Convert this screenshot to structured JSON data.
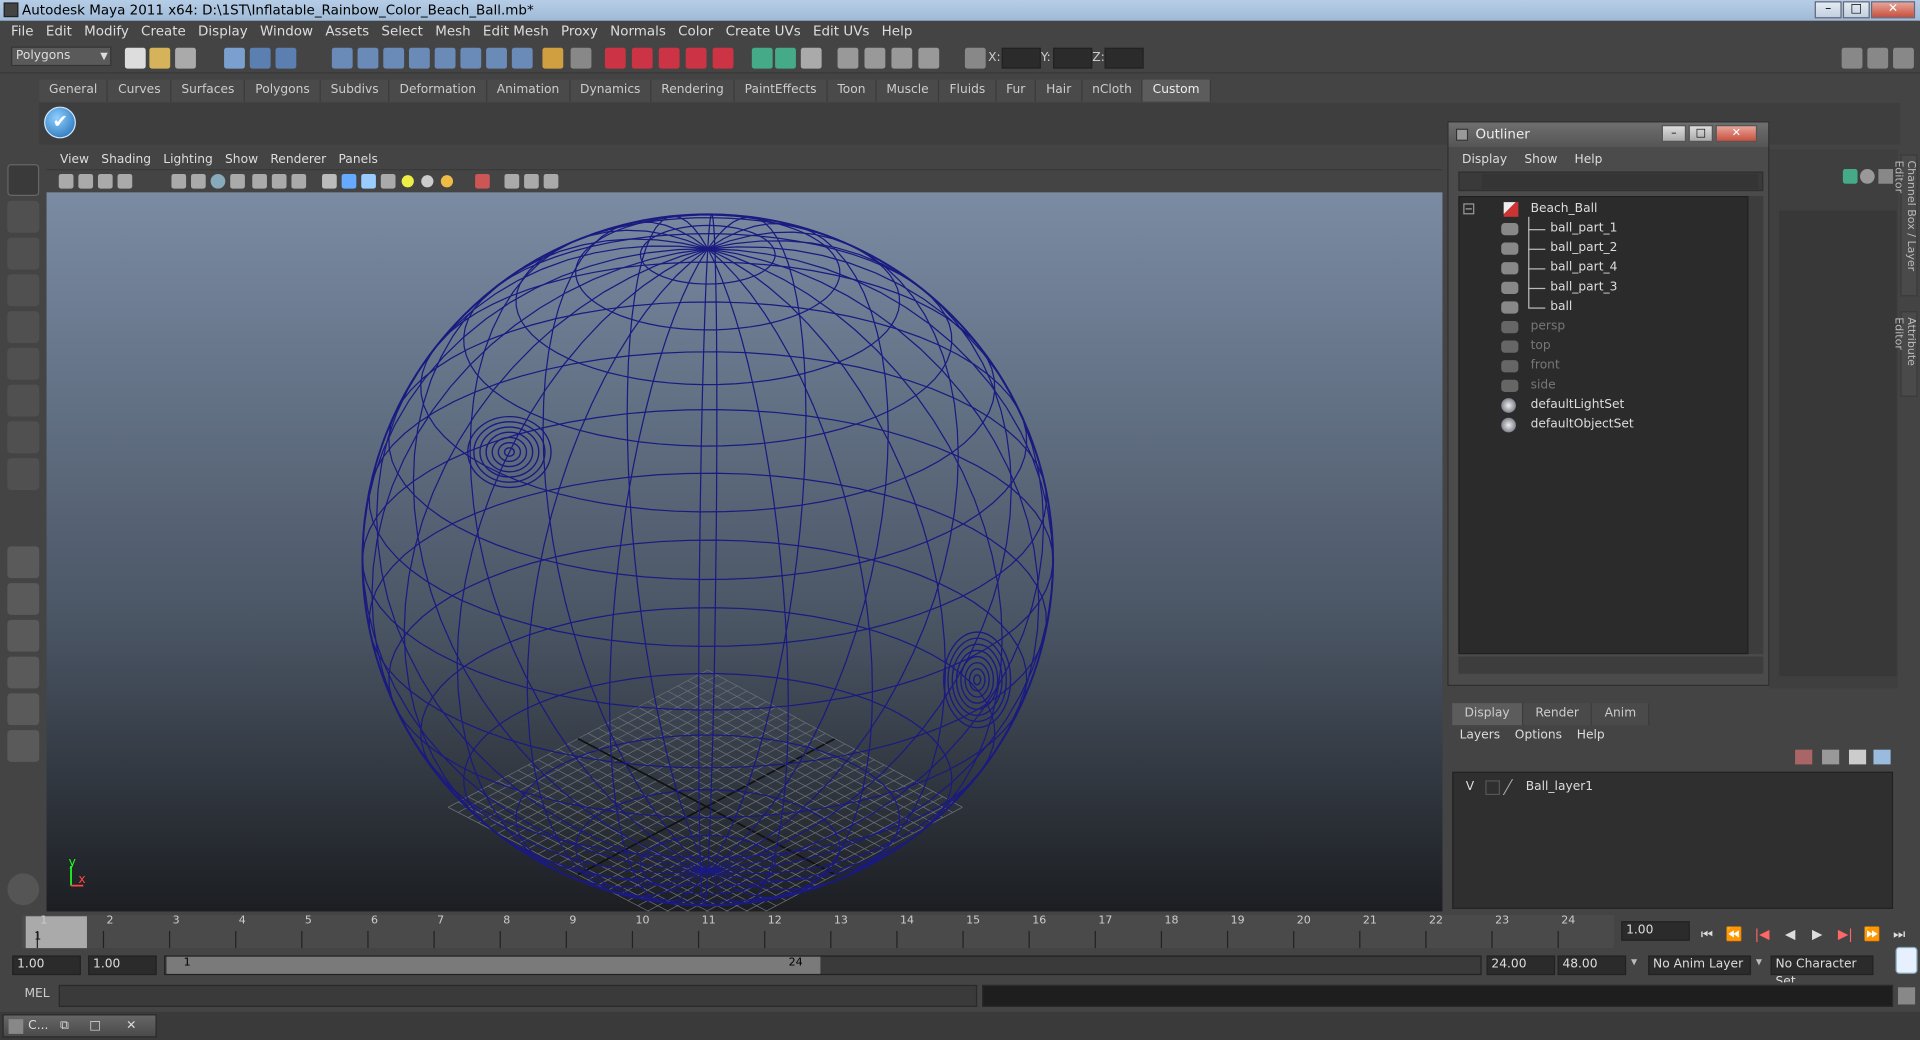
{
  "window": {
    "title": "Autodesk Maya 2011 x64: D:\\1ST\\Inflatable_Rainbow_Color_Beach_Ball.mb*",
    "min": "–",
    "max": "□",
    "close": "✕"
  },
  "menubar": [
    "File",
    "Edit",
    "Modify",
    "Create",
    "Display",
    "Window",
    "Assets",
    "Select",
    "Mesh",
    "Edit Mesh",
    "Proxy",
    "Normals",
    "Color",
    "Create UVs",
    "Edit UVs",
    "Help"
  ],
  "statusline": {
    "menuset": "Polygons",
    "x_label": "X:",
    "y_label": "Y:",
    "z_label": "Z:"
  },
  "shelf": {
    "tabs": [
      "General",
      "Curves",
      "Surfaces",
      "Polygons",
      "Subdivs",
      "Deformation",
      "Animation",
      "Dynamics",
      "Rendering",
      "PaintEffects",
      "Toon",
      "Muscle",
      "Fluids",
      "Fur",
      "Hair",
      "nCloth",
      "Custom"
    ],
    "active_tab": "Custom",
    "icon": "checkmark-icon",
    "icon_glyph": "✔"
  },
  "viewport": {
    "menu": [
      "View",
      "Shading",
      "Lighting",
      "Show",
      "Renderer",
      "Panels"
    ],
    "axis_x": "x",
    "axis_y": "y",
    "wire_color": "#1a1a80"
  },
  "outliner": {
    "title": "Outliner",
    "menu": [
      "Display",
      "Show",
      "Help"
    ],
    "items": [
      {
        "label": "Beach_Ball",
        "kind": "group",
        "dim": false
      },
      {
        "label": "ball_part_1",
        "kind": "mesh",
        "dim": false
      },
      {
        "label": "ball_part_2",
        "kind": "mesh",
        "dim": false
      },
      {
        "label": "ball_part_4",
        "kind": "mesh",
        "dim": false
      },
      {
        "label": "ball_part_3",
        "kind": "mesh",
        "dim": false
      },
      {
        "label": "ball",
        "kind": "mesh",
        "dim": false
      },
      {
        "label": "persp",
        "kind": "camera",
        "dim": true
      },
      {
        "label": "top",
        "kind": "camera",
        "dim": true
      },
      {
        "label": "front",
        "kind": "camera",
        "dim": true
      },
      {
        "label": "side",
        "kind": "camera",
        "dim": true
      },
      {
        "label": "defaultLightSet",
        "kind": "set",
        "dim": false
      },
      {
        "label": "defaultObjectSet",
        "kind": "set",
        "dim": false
      }
    ],
    "collapse": "−"
  },
  "sidetabs": [
    "Channel Box / Layer Editor",
    "Attribute Editor"
  ],
  "layers": {
    "tabs": [
      "Display",
      "Render",
      "Anim"
    ],
    "active_tab": "Display",
    "menu": [
      "Layers",
      "Options",
      "Help"
    ],
    "rows": [
      {
        "visible": "V",
        "name": "Ball_layer1"
      }
    ]
  },
  "timeline": {
    "ticks": [
      "1",
      "2",
      "3",
      "4",
      "5",
      "6",
      "7",
      "8",
      "9",
      "10",
      "11",
      "12",
      "13",
      "14",
      "15",
      "16",
      "17",
      "18",
      "19",
      "20",
      "21",
      "22",
      "23",
      "24"
    ],
    "current": "1",
    "current_field": "1.00"
  },
  "playback": [
    "⏮",
    "⏪",
    "|◀",
    "◀",
    "▶",
    "▶|",
    "⏩",
    "⏭"
  ],
  "range": {
    "start": "1.00",
    "anim_start": "1.00",
    "slider_start": "1",
    "slider_end": "24",
    "anim_end": "24.00",
    "end": "48.00",
    "anim_layer": "No Anim Layer",
    "char_set": "No Character Set"
  },
  "cmdline": {
    "lang": "MEL"
  },
  "taskbar": {
    "item": "C...",
    "b1": "⧉",
    "b2": "□",
    "b3": "✕"
  }
}
